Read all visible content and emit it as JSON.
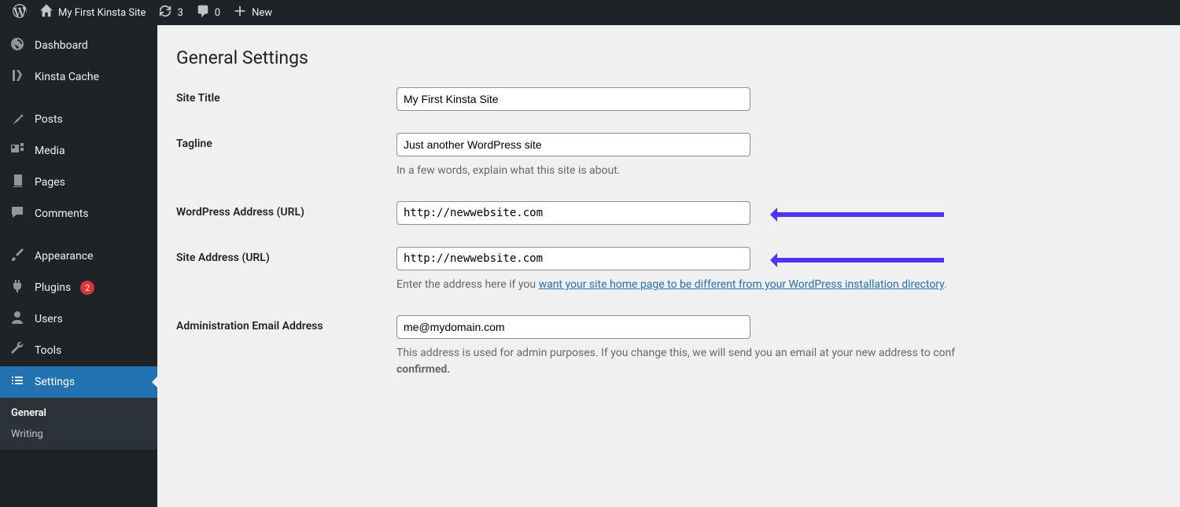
{
  "adminbar": {
    "site_name": "My First Kinsta Site",
    "updates_count": "3",
    "comments_count": "0",
    "new_label": "New"
  },
  "sidebar": {
    "dashboard": "Dashboard",
    "kinsta_cache": "Kinsta Cache",
    "posts": "Posts",
    "media": "Media",
    "pages": "Pages",
    "comments": "Comments",
    "appearance": "Appearance",
    "plugins": "Plugins",
    "plugins_badge": "2",
    "users": "Users",
    "tools": "Tools",
    "settings": "Settings",
    "submenu": {
      "general": "General",
      "writing": "Writing"
    }
  },
  "page": {
    "title": "General Settings",
    "rows": {
      "site_title": {
        "label": "Site Title",
        "value": "My First Kinsta Site"
      },
      "tagline": {
        "label": "Tagline",
        "value": "Just another WordPress site",
        "desc": "In a few words, explain what this site is about."
      },
      "wp_url": {
        "label": "WordPress Address (URL)",
        "value": "http://newwebsite.com"
      },
      "site_url": {
        "label": "Site Address (URL)",
        "value": "http://newwebsite.com",
        "desc_pre": "Enter the address here if you ",
        "desc_link": "want your site home page to be different from your WordPress installation directory",
        "desc_post": "."
      },
      "admin_email": {
        "label": "Administration Email Address",
        "value": "me@mydomain.com",
        "desc_pre": "This address is used for admin purposes. If you change this, we will send you an email at your new address to conf",
        "desc_bold": "confirmed."
      }
    }
  }
}
